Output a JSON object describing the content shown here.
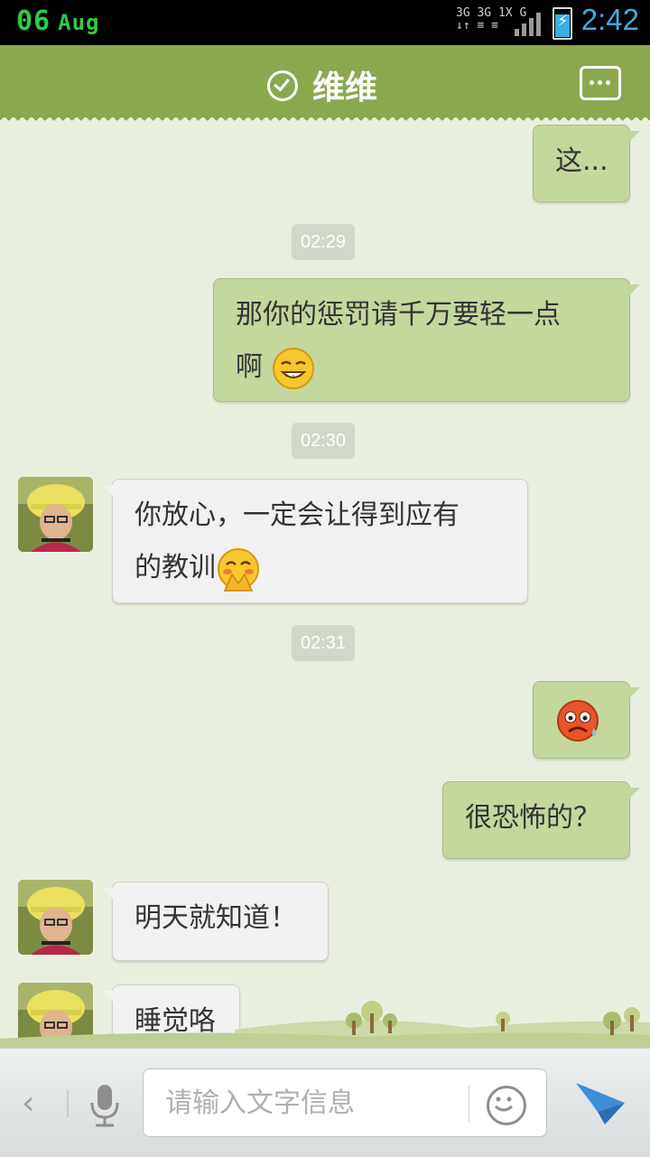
{
  "status_bar": {
    "date_day": "06",
    "date_month": "Aug",
    "network_top": "3G 3G 1X G",
    "network_bottom": "↓↑ ≡ ≡",
    "time": "2:42",
    "battery_level": 0.78,
    "accent_color": "#38b0e3"
  },
  "header": {
    "title": "维维",
    "verified_icon": "check-circle-icon",
    "menu_icon": "more-dots-icon",
    "color": "#8ba84f"
  },
  "messages": [
    {
      "type": "out",
      "text": "这..."
    },
    {
      "type": "time",
      "text": "02:29"
    },
    {
      "type": "out",
      "text_line1": "那你的惩罚请千万要轻一点",
      "text_line2": "啊",
      "emoji": "smirk-emoji"
    },
    {
      "type": "time",
      "text": "02:30"
    },
    {
      "type": "in",
      "text_line1": "你放心，一定会让得到应有",
      "text_line2": "的教训",
      "emoji": "shy-emoji"
    },
    {
      "type": "time",
      "text": "02:31"
    },
    {
      "type": "out",
      "emoji": "scared-sweat-emoji"
    },
    {
      "type": "out",
      "text": "很恐怖的？"
    },
    {
      "type": "in",
      "text": "明天就知道！"
    },
    {
      "type": "in",
      "text": "睡觉咯"
    }
  ],
  "input_bar": {
    "placeholder": "请输入文字信息",
    "back_icon": "chevron-left-icon",
    "voice_icon": "microphone-icon",
    "emoji_icon": "smiley-icon",
    "send_icon": "paper-plane-icon"
  }
}
